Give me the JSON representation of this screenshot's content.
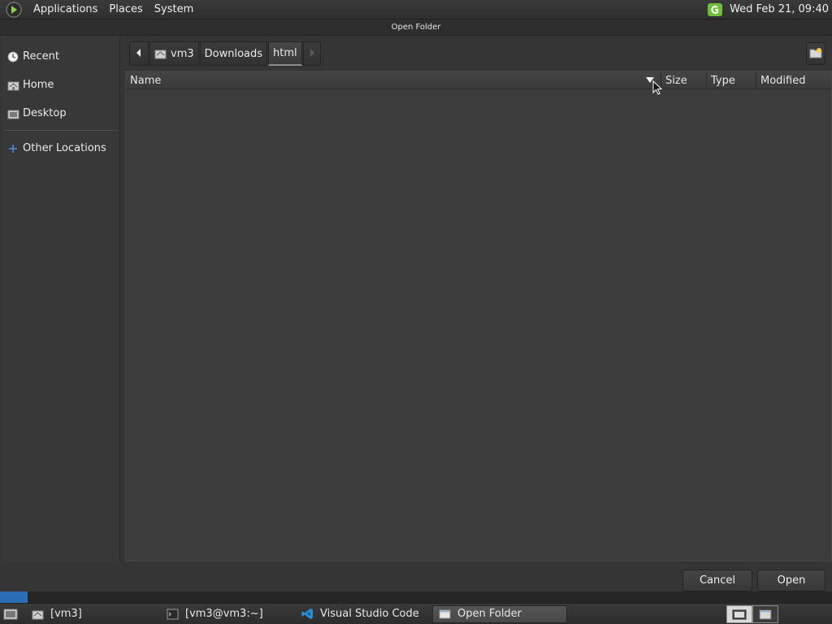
{
  "top_panel": {
    "menus": [
      "Applications",
      "Places",
      "System"
    ],
    "clock": "Wed Feb 21, 09:40"
  },
  "dialog": {
    "title": "Open Folder",
    "sidebar": {
      "items": [
        {
          "label": "Recent",
          "icon": "clock-icon"
        },
        {
          "label": "Home",
          "icon": "home-icon"
        },
        {
          "label": "Desktop",
          "icon": "desktop-icon"
        }
      ],
      "other": {
        "label": "Other Locations",
        "icon": "plus-icon"
      }
    },
    "pathbar": {
      "segments": [
        "vm3",
        "Downloads",
        "html"
      ],
      "active": "html"
    },
    "columns": {
      "name": "Name",
      "size": "Size",
      "type": "Type",
      "modified": "Modified"
    },
    "buttons": {
      "cancel": "Cancel",
      "open": "Open"
    }
  },
  "taskbar": {
    "tasks": [
      {
        "label": "[vm3]",
        "icon": "folder-icon"
      },
      {
        "label": "[vm3@vm3:~]",
        "icon": "terminal-icon"
      },
      {
        "label": "Visual Studio Code",
        "icon": "vscode-icon"
      },
      {
        "label": "Open Folder",
        "icon": "window-icon",
        "active": true
      }
    ]
  },
  "colors": {
    "accent": "#6fbf3a",
    "vscode_blue": "#2d6db5",
    "other_locations_plus": "#4a90d9"
  }
}
